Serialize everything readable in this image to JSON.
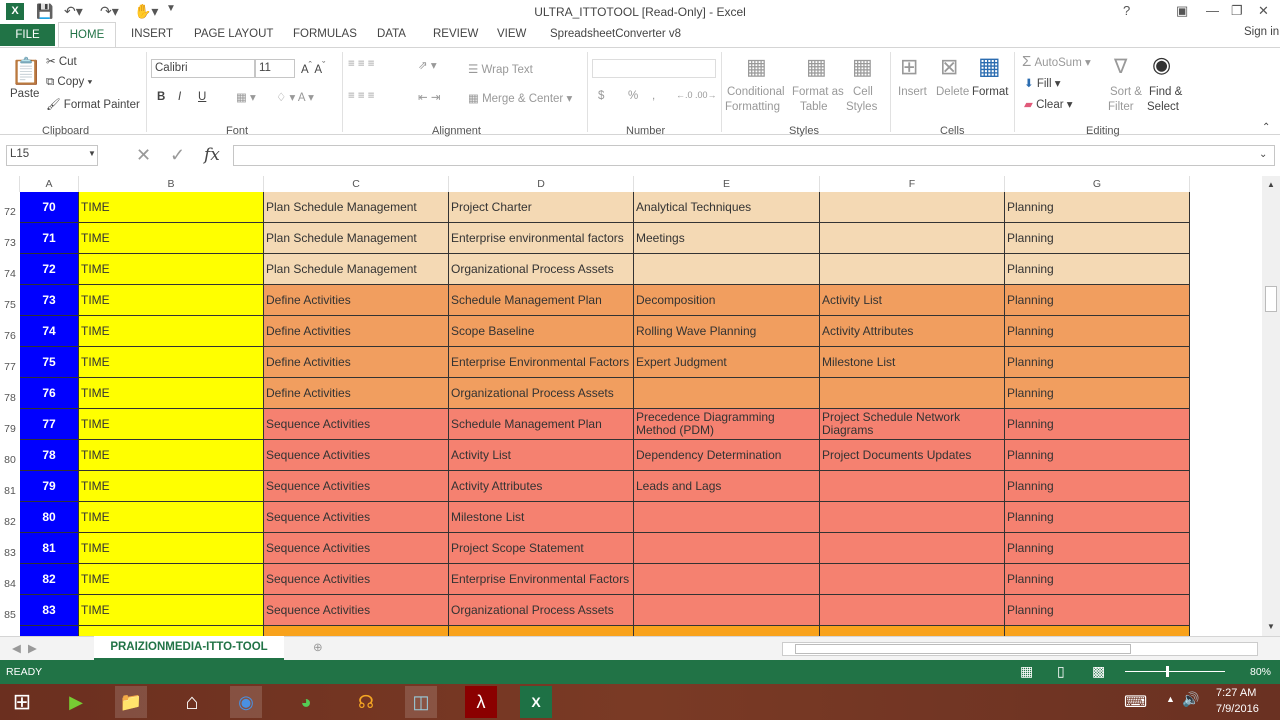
{
  "app": {
    "title": "ULTRA_ITTOTOOL  [Read-Only] - Excel",
    "sign_in": "Sign in",
    "window_buttons": [
      "?",
      "restore-ribbon",
      "minimize",
      "maximize",
      "close"
    ]
  },
  "tabs": [
    "FILE",
    "HOME",
    "INSERT",
    "PAGE LAYOUT",
    "FORMULAS",
    "DATA",
    "REVIEW",
    "VIEW",
    "SpreadsheetConverter v8"
  ],
  "ribbon": {
    "clipboard": {
      "paste": "Paste",
      "cut": "Cut",
      "copy": "Copy",
      "format_painter": "Format Painter",
      "label": "Clipboard"
    },
    "font": {
      "name": "Calibri",
      "size": "11",
      "bold": "B",
      "italic": "I",
      "underline": "U",
      "label": "Font"
    },
    "alignment": {
      "wrap": "Wrap Text",
      "merge": "Merge & Center",
      "label": "Alignment"
    },
    "number": {
      "format": "",
      "currency": "$",
      "percent": "%",
      "comma": ",",
      "label": "Number"
    },
    "styles": {
      "cond1": "Conditional",
      "cond2": "Formatting",
      "fmt1": "Format as",
      "fmt2": "Table",
      "cell1": "Cell",
      "cell2": "Styles",
      "label": "Styles"
    },
    "cells": {
      "insert": "Insert",
      "delete": "Delete",
      "format": "Format",
      "label": "Cells"
    },
    "editing": {
      "autosum": "AutoSum",
      "fill": "Fill",
      "clear": "Clear",
      "sort1": "Sort &",
      "sort2": "Filter",
      "find1": "Find &",
      "find2": "Select",
      "label": "Editing"
    }
  },
  "formula_bar": {
    "name_box": "L15",
    "fx": "fx",
    "value": ""
  },
  "columns": [
    "A",
    "B",
    "C",
    "D",
    "E",
    "F",
    "G"
  ],
  "colors": {
    "A": "#0000ff",
    "B": "#ffff00",
    "plan": "#f4d9b4",
    "define": "#f19e5f",
    "sequence": "#f58170",
    "next": "#f8a21c",
    "excel_green": "#217346"
  },
  "rows": [
    {
      "rn": "72",
      "a": "70",
      "b": "TIME",
      "c": "Plan Schedule Management",
      "d": "Project Charter",
      "e": "Analytical Techniques",
      "f": "",
      "g": "Planning",
      "fill": "plan"
    },
    {
      "rn": "73",
      "a": "71",
      "b": "TIME",
      "c": "Plan Schedule Management",
      "d": "Enterprise environmental factors",
      "e": "Meetings",
      "f": "",
      "g": "Planning",
      "fill": "plan"
    },
    {
      "rn": "74",
      "a": "72",
      "b": "TIME",
      "c": "Plan Schedule Management",
      "d": "Organizational Process Assets",
      "e": "",
      "f": "",
      "g": "Planning",
      "fill": "plan"
    },
    {
      "rn": "75",
      "a": "73",
      "b": "TIME",
      "c": "Define Activities",
      "d": "Schedule Management Plan",
      "e": "Decomposition",
      "f": "Activity List",
      "g": "Planning",
      "fill": "define"
    },
    {
      "rn": "76",
      "a": "74",
      "b": "TIME",
      "c": "Define Activities",
      "d": "Scope Baseline",
      "e": "Rolling Wave Planning",
      "f": "Activity Attributes",
      "g": "Planning",
      "fill": "define"
    },
    {
      "rn": "77",
      "a": "75",
      "b": "TIME",
      "c": "Define Activities",
      "d": "Enterprise Environmental Factors",
      "e": "Expert Judgment",
      "f": "Milestone List",
      "g": "Planning",
      "fill": "define"
    },
    {
      "rn": "78",
      "a": "76",
      "b": "TIME",
      "c": "Define Activities",
      "d": "Organizational Process Assets",
      "e": "",
      "f": "",
      "g": "Planning",
      "fill": "define"
    },
    {
      "rn": "79",
      "a": "77",
      "b": "TIME",
      "c": "Sequence Activities",
      "d": "Schedule Management Plan",
      "e": "Precedence Diagramming Method (PDM)",
      "f": "Project Schedule Network Diagrams",
      "g": "Planning",
      "fill": "sequence"
    },
    {
      "rn": "80",
      "a": "78",
      "b": "TIME",
      "c": "Sequence Activities",
      "d": "Activity List",
      "e": "Dependency Determination",
      "f": "Project Documents Updates",
      "g": "Planning",
      "fill": "sequence"
    },
    {
      "rn": "81",
      "a": "79",
      "b": "TIME",
      "c": "Sequence Activities",
      "d": "Activity Attributes",
      "e": "Leads and Lags",
      "f": "",
      "g": "Planning",
      "fill": "sequence"
    },
    {
      "rn": "82",
      "a": "80",
      "b": "TIME",
      "c": "Sequence Activities",
      "d": "Milestone List",
      "e": "",
      "f": "",
      "g": "Planning",
      "fill": "sequence"
    },
    {
      "rn": "83",
      "a": "81",
      "b": "TIME",
      "c": "Sequence Activities",
      "d": "Project Scope Statement",
      "e": "",
      "f": "",
      "g": "Planning",
      "fill": "sequence"
    },
    {
      "rn": "84",
      "a": "82",
      "b": "TIME",
      "c": "Sequence Activities",
      "d": "Enterprise Environmental Factors",
      "e": "",
      "f": "",
      "g": "Planning",
      "fill": "sequence"
    },
    {
      "rn": "85",
      "a": "83",
      "b": "TIME",
      "c": "Sequence Activities",
      "d": "Organizational Process Assets",
      "e": "",
      "f": "",
      "g": "Planning",
      "fill": "sequence"
    }
  ],
  "sheet_tab": "PRAIZIONMEDIA-ITTO-TOOL",
  "status": {
    "text": "READY",
    "zoom": "80%"
  },
  "taskbar": {
    "time": "7:27 AM",
    "date": "7/9/2016",
    "apps": [
      "windows-start",
      "media-player",
      "file-explorer",
      "home",
      "chrome",
      "app-green",
      "headphones",
      "app-blue",
      "acrobat",
      "excel"
    ]
  }
}
